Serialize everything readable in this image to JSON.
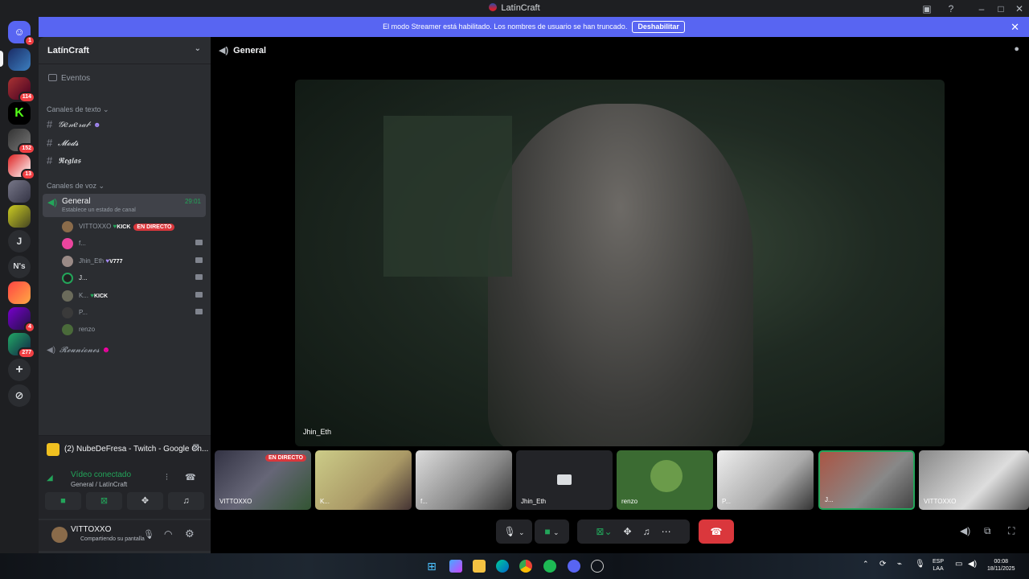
{
  "window": {
    "title": "LatínCraft"
  },
  "banner": {
    "text": "El modo Streamer está habilitado. Los nombres de usuario se han truncado.",
    "button": "Deshabilitar"
  },
  "rail": {
    "badges": [
      "1",
      "114",
      "152",
      "13",
      "4",
      "277"
    ],
    "letters": [
      "J",
      "N's"
    ]
  },
  "guild": {
    "name": "LatínCraft"
  },
  "events": "Eventos",
  "text_category": "Canales de texto",
  "text_channels": [
    "𝒢𝑒𝓃𝑒𝓇𝒶𝓁-",
    "𝓜𝓸𝓭𝓼",
    "𝕽𝖊𝖌𝖑𝖆𝖘"
  ],
  "voice_category": "Canales de voz",
  "voice_channel": {
    "name": "General",
    "status": "Establece un estado de canal",
    "time": "29:01"
  },
  "voice_users": [
    {
      "name": "VITTOXXO",
      "tag": "KICK",
      "live": "EN DIRECTO"
    },
    {
      "name": "f..."
    },
    {
      "name": "Jhin_Eth",
      "tag": "V777"
    },
    {
      "name": "J..."
    },
    {
      "name": "K...",
      "tag": "KICK"
    },
    {
      "name": "P..."
    },
    {
      "name": "renzo"
    }
  ],
  "voice_channel2": "𝓡𝓮𝓾𝓷𝓲𝓸𝓷𝓮𝓼",
  "now_playing": "(2) NubeDeFresa - Twitch - Google Ch...",
  "voice_panel": {
    "status": "Vídeo conectado",
    "location": "General / LatínCraft"
  },
  "user_panel": {
    "name": "VITTOXXO",
    "status": "Compartiendo su pantalla"
  },
  "main": {
    "channel": "General",
    "video_label": "Jhin_Eth"
  },
  "tiles": [
    {
      "label": "VITTOXXO",
      "live": "EN DIRECTO"
    },
    {
      "label": "K..."
    },
    {
      "label": "f..."
    },
    {
      "label": "Jhin_Eth"
    },
    {
      "label": "renzo"
    },
    {
      "label": "P..."
    },
    {
      "label": "J..."
    },
    {
      "label": "VITTOXXO"
    }
  ],
  "taskbar": {
    "lang1": "ESP",
    "lang2": "LAA",
    "time": "00:08",
    "date": "18/11/2025"
  },
  "colors": {
    "blurple": "#5865f2",
    "green": "#23a55a",
    "red": "#da373c"
  }
}
